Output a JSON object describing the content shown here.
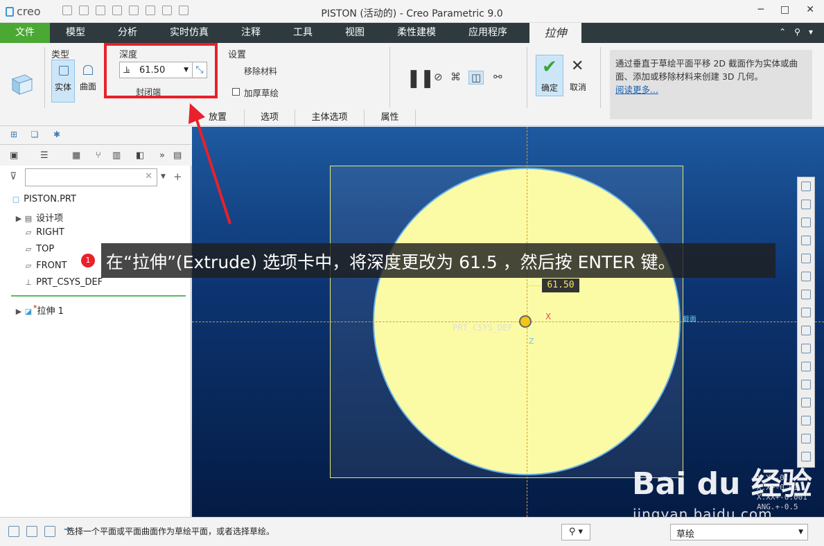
{
  "window": {
    "logo": "creo",
    "title": "PISTON (活动的) - Creo Parametric 9.0",
    "minimize": "─",
    "maximize": "□",
    "close": "✕"
  },
  "menu": {
    "file": "文件",
    "tabs": [
      "模型",
      "分析",
      "实时仿真",
      "注释",
      "工具",
      "视图",
      "柔性建模",
      "应用程序"
    ],
    "active": "拉伸"
  },
  "ribbon": {
    "type_label": "类型",
    "solid": "实体",
    "surface": "曲面",
    "depth_label": "深度",
    "depth_value": "61.50",
    "close_ends": "封闭端",
    "settings_label": "设置",
    "remove_material": "移除材料",
    "thicken_sketch": "加厚草绘",
    "ok": "确定",
    "cancel": "取消",
    "subtabs": [
      "放置",
      "选项",
      "主体选项",
      "属性"
    ],
    "help_text": "通过垂直于草绘平面平移 2D 截面作为实体或曲面、添加或移除材料来创建 3D 几何。",
    "help_link": "阅读更多..."
  },
  "tree": {
    "root": "PISTON.PRT",
    "items": [
      "设计项",
      "RIGHT",
      "TOP",
      "FRONT",
      "PRT_CSYS_DEF"
    ],
    "feature_mark": "*",
    "feature": "拉伸 1"
  },
  "viewport": {
    "dim_value": "61.50",
    "csys_label": "PRT_CSYS_DEF",
    "x_axis": "X",
    "z_axis": "Z",
    "edge_label": "截面",
    "coords": [
      "X Y+-0.1",
      "X.X+-0.01",
      "X.XX+-0.001",
      "ANG.+-0.5"
    ]
  },
  "callout": {
    "badge": "1",
    "text": "在“拉伸”(Extrude) 选项卡中，将深度更改为 61.5 ，然后按 ENTER 键。"
  },
  "watermark": {
    "brand": "Bai du 经验",
    "url": "jingyan.baidu.com"
  },
  "status": {
    "message": "选择一个平面或平面曲面作为草绘平面，或者选择草绘。",
    "filter": "草绘"
  }
}
